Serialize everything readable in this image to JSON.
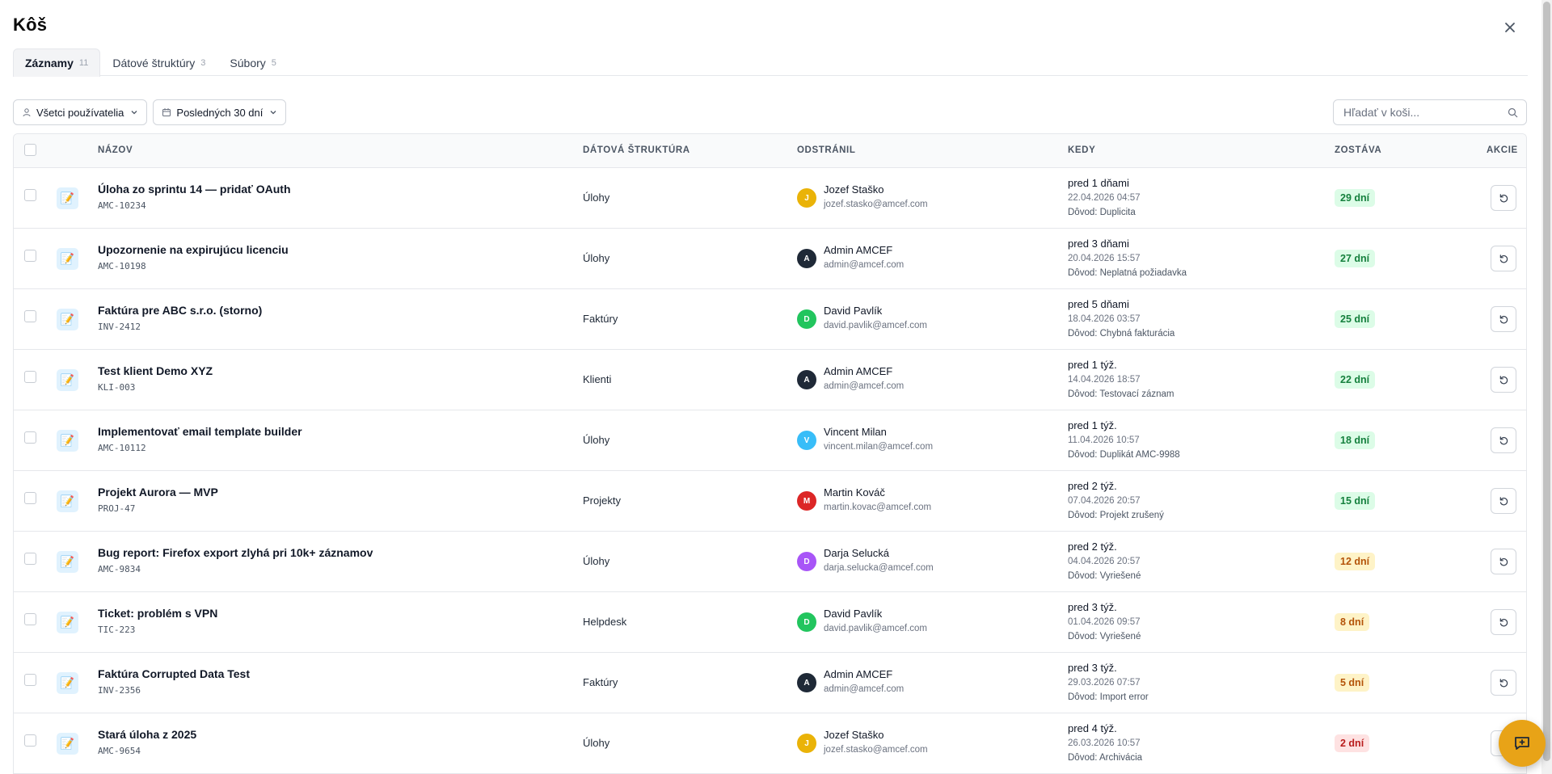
{
  "header": {
    "title": "Kôš"
  },
  "tabs": [
    {
      "label": "Záznamy",
      "count": "11",
      "active": true
    },
    {
      "label": "Dátové štruktúry",
      "count": "3",
      "active": false
    },
    {
      "label": "Súbory",
      "count": "5",
      "active": false
    }
  ],
  "filters": {
    "users": {
      "label": "Všetci používatelia",
      "icon": "user-icon"
    },
    "period": {
      "label": "Posledných 30 dní",
      "icon": "calendar-icon"
    }
  },
  "search": {
    "placeholder": "Hľadať v koši...",
    "icon": "search-icon"
  },
  "columns": {
    "name": "NÁZOV",
    "structure": "DÁTOVÁ ŠTRUKTÚRA",
    "removed_by": "ODSTRÁNIL",
    "when": "KEDY",
    "remaining": "ZOSTÁVA",
    "actions": "AKCIE"
  },
  "rows": [
    {
      "icon": "📝",
      "name": "Úloha zo sprintu 14 — pridať OAuth",
      "code": "AMC-10234",
      "structure": "Úlohy",
      "initial": "J",
      "avatar_color": "#eab308",
      "user": "Jozef Staško",
      "email": "jozef.stasko@amcef.com",
      "when": "pred 1 dňami",
      "date": "22.04.2026 04:57",
      "reason": "Dôvod: Duplicita",
      "remaining": "29 dní",
      "level": "ok"
    },
    {
      "icon": "📝",
      "name": "Upozornenie na expirujúcu licenciu",
      "code": "AMC-10198",
      "structure": "Úlohy",
      "initial": "A",
      "avatar_color": "#1f2937",
      "user": "Admin AMCEF",
      "email": "admin@amcef.com",
      "when": "pred 3 dňami",
      "date": "20.04.2026 15:57",
      "reason": "Dôvod: Neplatná požiadavka",
      "remaining": "27 dní",
      "level": "ok"
    },
    {
      "icon": "📝",
      "name": "Faktúra pre ABC s.r.o. (storno)",
      "code": "INV-2412",
      "structure": "Faktúry",
      "initial": "D",
      "avatar_color": "#22c55e",
      "user": "David Pavlík",
      "email": "david.pavlik@amcef.com",
      "when": "pred 5 dňami",
      "date": "18.04.2026 03:57",
      "reason": "Dôvod: Chybná fakturácia",
      "remaining": "25 dní",
      "level": "ok"
    },
    {
      "icon": "📝",
      "name": "Test klient Demo XYZ",
      "code": "KLI-003",
      "structure": "Klienti",
      "initial": "A",
      "avatar_color": "#1f2937",
      "user": "Admin AMCEF",
      "email": "admin@amcef.com",
      "when": "pred 1 týž.",
      "date": "14.04.2026 18:57",
      "reason": "Dôvod: Testovací záznam",
      "remaining": "22 dní",
      "level": "ok"
    },
    {
      "icon": "📝",
      "name": "Implementovať email template builder",
      "code": "AMC-10112",
      "structure": "Úlohy",
      "initial": "V",
      "avatar_color": "#38bdf8",
      "user": "Vincent Milan",
      "email": "vincent.milan@amcef.com",
      "when": "pred 1 týž.",
      "date": "11.04.2026 10:57",
      "reason": "Dôvod: Duplikát AMC-9988",
      "remaining": "18 dní",
      "level": "ok"
    },
    {
      "icon": "📝",
      "name": "Projekt Aurora — MVP",
      "code": "PROJ-47",
      "structure": "Projekty",
      "initial": "M",
      "avatar_color": "#dc2626",
      "user": "Martin Kováč",
      "email": "martin.kovac@amcef.com",
      "when": "pred 2 týž.",
      "date": "07.04.2026 20:57",
      "reason": "Dôvod: Projekt zrušený",
      "remaining": "15 dní",
      "level": "ok"
    },
    {
      "icon": "📝",
      "name": "Bug report: Firefox export zlyhá pri 10k+ záznamov",
      "code": "AMC-9834",
      "structure": "Úlohy",
      "initial": "D",
      "avatar_color": "#a855f7",
      "user": "Darja Selucká",
      "email": "darja.selucka@amcef.com",
      "when": "pred 2 týž.",
      "date": "04.04.2026 20:57",
      "reason": "Dôvod: Vyriešené",
      "remaining": "12 dní",
      "level": "warn"
    },
    {
      "icon": "📝",
      "name": "Ticket: problém s VPN",
      "code": "TIC-223",
      "structure": "Helpdesk",
      "initial": "D",
      "avatar_color": "#22c55e",
      "user": "David Pavlík",
      "email": "david.pavlik@amcef.com",
      "when": "pred 3 týž.",
      "date": "01.04.2026 09:57",
      "reason": "Dôvod: Vyriešené",
      "remaining": "8 dní",
      "level": "warn"
    },
    {
      "icon": "📝",
      "name": "Faktúra Corrupted Data Test",
      "code": "INV-2356",
      "structure": "Faktúry",
      "initial": "A",
      "avatar_color": "#1f2937",
      "user": "Admin AMCEF",
      "email": "admin@amcef.com",
      "when": "pred 3 týž.",
      "date": "29.03.2026 07:57",
      "reason": "Dôvod: Import error",
      "remaining": "5 dní",
      "level": "warn"
    },
    {
      "icon": "📝",
      "name": "Stará úloha z 2025",
      "code": "AMC-9654",
      "structure": "Úlohy",
      "initial": "J",
      "avatar_color": "#eab308",
      "user": "Jozef Staško",
      "email": "jozef.stasko@amcef.com",
      "when": "pred 4 týž.",
      "date": "26.03.2026 10:57",
      "reason": "Dôvod: Archivácia",
      "remaining": "2 dní",
      "level": "danger"
    }
  ],
  "badge_colors": {
    "ok": {
      "bg": "#dcfce7",
      "fg": "#15803d"
    },
    "warn": {
      "bg": "#fef3c7",
      "fg": "#b45309"
    },
    "danger": {
      "bg": "#fee2e2",
      "fg": "#b91c1c"
    }
  },
  "chat": {
    "icon": "chat-icon",
    "color": "#e8a317"
  }
}
